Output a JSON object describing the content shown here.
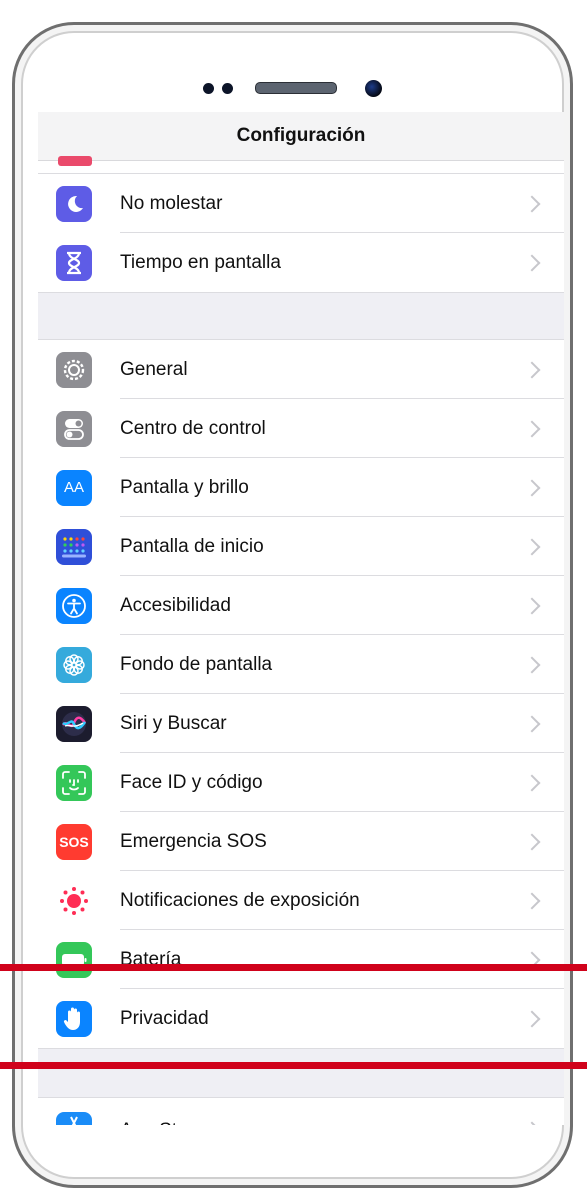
{
  "nav": {
    "title": "Configuración"
  },
  "group1": [
    {
      "label": "No molestar",
      "icon": "moon-icon",
      "color": "#5e5ce6"
    },
    {
      "label": "Tiempo en pantalla",
      "icon": "hourglass-icon",
      "color": "#5e5ce6"
    }
  ],
  "group2": [
    {
      "label": "General",
      "icon": "gear-icon",
      "color": "#8e8e93"
    },
    {
      "label": "Centro de control",
      "icon": "toggles-icon",
      "color": "#8e8e93"
    },
    {
      "label": "Pantalla y brillo",
      "icon": "text-size-icon",
      "color": "#0a84ff"
    },
    {
      "label": "Pantalla de inicio",
      "icon": "home-grid-icon",
      "color": "#2f4fd8"
    },
    {
      "label": "Accesibilidad",
      "icon": "accessibility-icon",
      "color": "#0a84ff"
    },
    {
      "label": "Fondo de pantalla",
      "icon": "flower-icon",
      "color": "#35aadc"
    },
    {
      "label": "Siri y Buscar",
      "icon": "siri-icon",
      "color": "#1c1c2e"
    },
    {
      "label": "Face ID y código",
      "icon": "face-id-icon",
      "color": "#34c759"
    },
    {
      "label": "Emergencia SOS",
      "icon": "sos-icon",
      "color": "#ff3b30"
    },
    {
      "label": "Notificaciones de exposición",
      "icon": "exposure-icon",
      "color": "#ffffff"
    },
    {
      "label": "Batería",
      "icon": "battery-icon",
      "color": "#34c759"
    },
    {
      "label": "Privacidad",
      "icon": "hand-icon",
      "color": "#0a84ff"
    }
  ],
  "group3": [
    {
      "label": "App Store",
      "icon": "app-store-icon",
      "color": "#1a8cf7"
    }
  ],
  "icon_texts": {
    "text_size": "AA",
    "sos": "SOS"
  },
  "highlight_color": "#d0021b"
}
